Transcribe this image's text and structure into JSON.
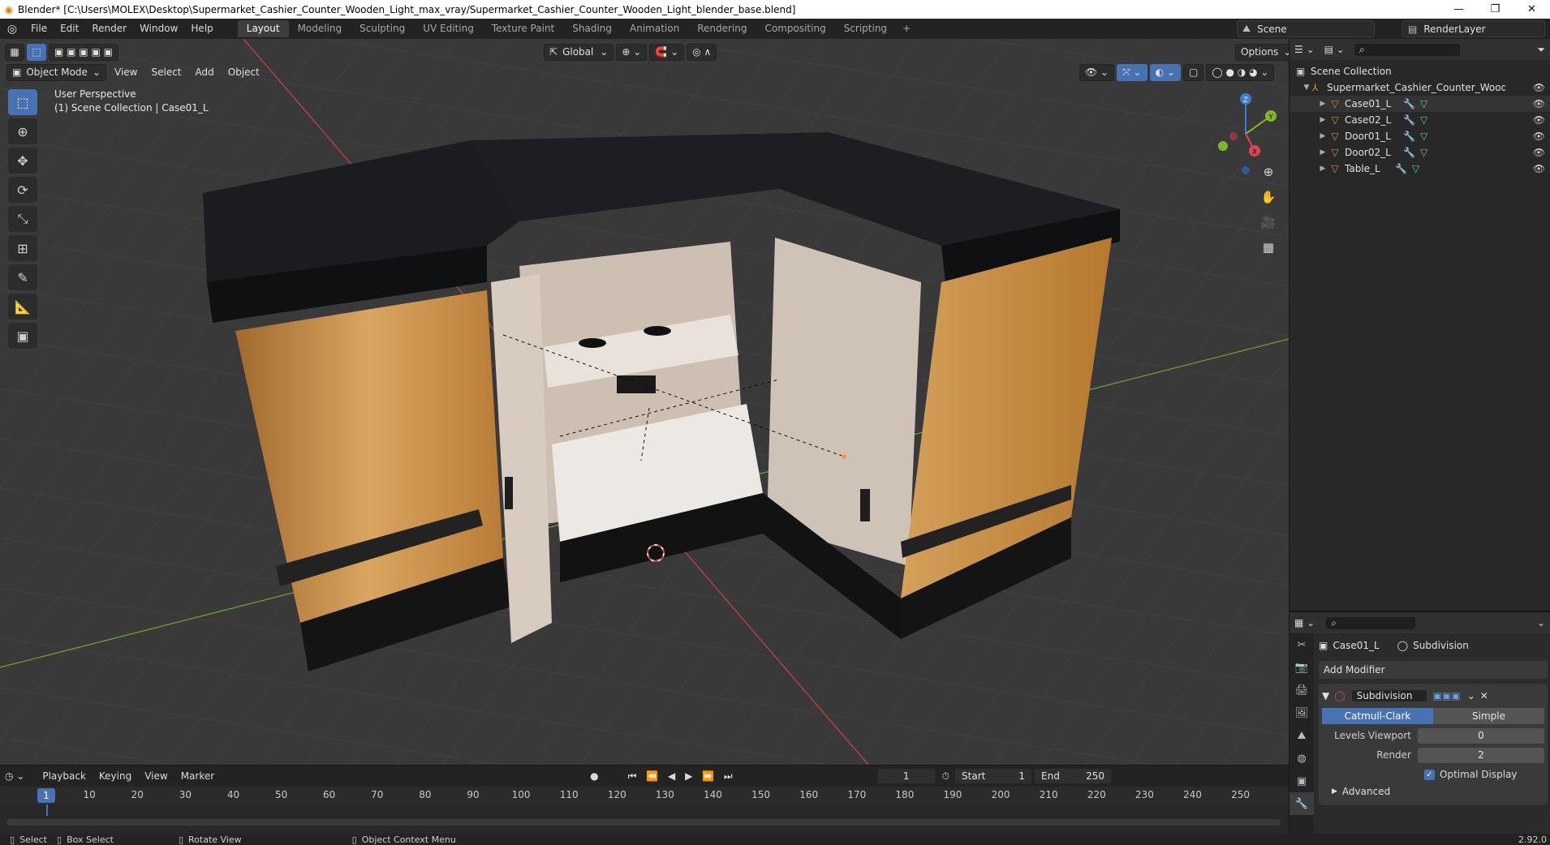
{
  "window": {
    "title": "Blender* [C:\\Users\\MOLEX\\Desktop\\Supermarket_Cashier_Counter_Wooden_Light_max_vray/Supermarket_Cashier_Counter_Wooden_Light_blender_base.blend]",
    "controls": [
      "—",
      "❐",
      "✕"
    ]
  },
  "menu": [
    "File",
    "Edit",
    "Render",
    "Window",
    "Help"
  ],
  "workspaces": [
    "Layout",
    "Modeling",
    "Sculpting",
    "UV Editing",
    "Texture Paint",
    "Shading",
    "Animation",
    "Rendering",
    "Compositing",
    "Scripting"
  ],
  "workspace_add": "+",
  "active_workspace": "Layout",
  "scene": {
    "name": "Scene",
    "render_layer": "RenderLayer"
  },
  "viewport": {
    "mode": "Object Mode",
    "menus": [
      "View",
      "Select",
      "Add",
      "Object"
    ],
    "transform_orientation": "Global",
    "options": "Options",
    "overlay_line1": "User Perspective",
    "overlay_line2": "(1) Scene Collection | Case01_L",
    "gizmo_axes": [
      "Z",
      "Y",
      "X"
    ]
  },
  "outliner": {
    "root": "Scene Collection",
    "collection": "Supermarket_Cashier_Counter_Wooden_Light",
    "objects": [
      "Case01_L",
      "Case02_L",
      "Door01_L",
      "Door02_L",
      "Table_L"
    ]
  },
  "properties": {
    "object": "Case01_L",
    "modifier_name": "Subdivision",
    "add_modifier": "Add Modifier",
    "modes": [
      "Catmull-Clark",
      "Simple"
    ],
    "active_mode": "Catmull-Clark",
    "levels_viewport_label": "Levels Viewport",
    "levels_viewport": "0",
    "render_label": "Render",
    "render_levels": "2",
    "optimal_display": "Optimal Display",
    "advanced": "Advanced"
  },
  "timeline": {
    "menus": [
      "Playback",
      "Keying",
      "View",
      "Marker"
    ],
    "current_frame": "1",
    "start_label": "Start",
    "start": "1",
    "end_label": "End",
    "end": "250",
    "ticks": [
      "10",
      "20",
      "30",
      "40",
      "50",
      "60",
      "70",
      "80",
      "90",
      "100",
      "110",
      "120",
      "130",
      "140",
      "150",
      "160",
      "170",
      "180",
      "190",
      "200",
      "210",
      "220",
      "230",
      "240",
      "250"
    ]
  },
  "statusbar": {
    "select": "Select",
    "box_select": "Box Select",
    "rotate_view": "Rotate View",
    "context_menu": "Object Context Menu",
    "version": "2.92.0"
  },
  "colors": {
    "accent": "#4772b3",
    "object_icon": "#e08c3a",
    "axis_x": "#e0464f",
    "axis_y": "#7fb72c",
    "axis_z": "#3d7bd9"
  }
}
